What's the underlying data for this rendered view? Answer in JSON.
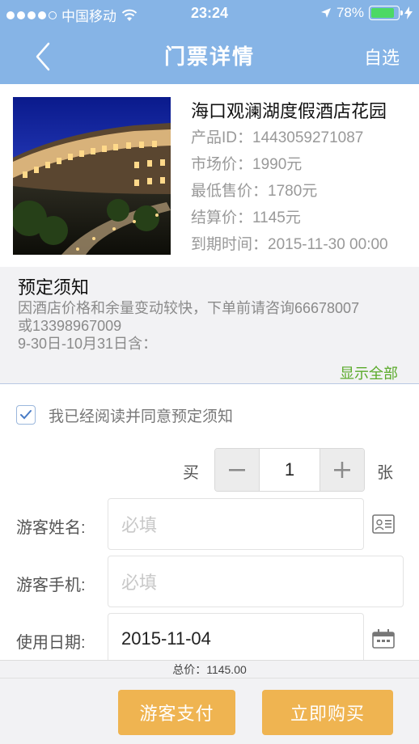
{
  "status_bar": {
    "carrier": "中国移动",
    "time": "23:24",
    "battery": "78%",
    "battery_level": 0.78
  },
  "nav": {
    "title": "门票详情",
    "right_label": "自选"
  },
  "product": {
    "name": "海口观澜湖度假酒店花园",
    "product_id": "产品ID：1443059271087",
    "market_price": "市场价：1990元",
    "min_price": "最低售价：1780元",
    "settle_price": "结算价：1145元",
    "expire": "到期时间：2015-11-30 00:00"
  },
  "notice": {
    "title": "预定须知",
    "line1": "因酒店价格和余量变动较快，下单前请咨询66678007",
    "line2": "或13398967009",
    "line3": "9-30日-10月31日含：",
    "show_all": "显示全部"
  },
  "agree": {
    "label": "我已经阅读并同意预定须知",
    "checked": true
  },
  "quantity": {
    "buy_label": "买",
    "value": "1",
    "unit": "张"
  },
  "form": {
    "name_label": "游客姓名:",
    "name_placeholder": "必填",
    "phone_label": "游客手机:",
    "phone_placeholder": "必填",
    "date_label": "使用日期:",
    "date_value": "2015-11-04"
  },
  "footer": {
    "total": "总价：1145.00",
    "pay_button": "游客支付",
    "buy_button": "立即购买"
  },
  "colors": {
    "header_bg": "#86b4e6",
    "accent_button": "#efb451",
    "show_all": "#5aaa2a",
    "notice_bg": "#f2f2f4"
  }
}
